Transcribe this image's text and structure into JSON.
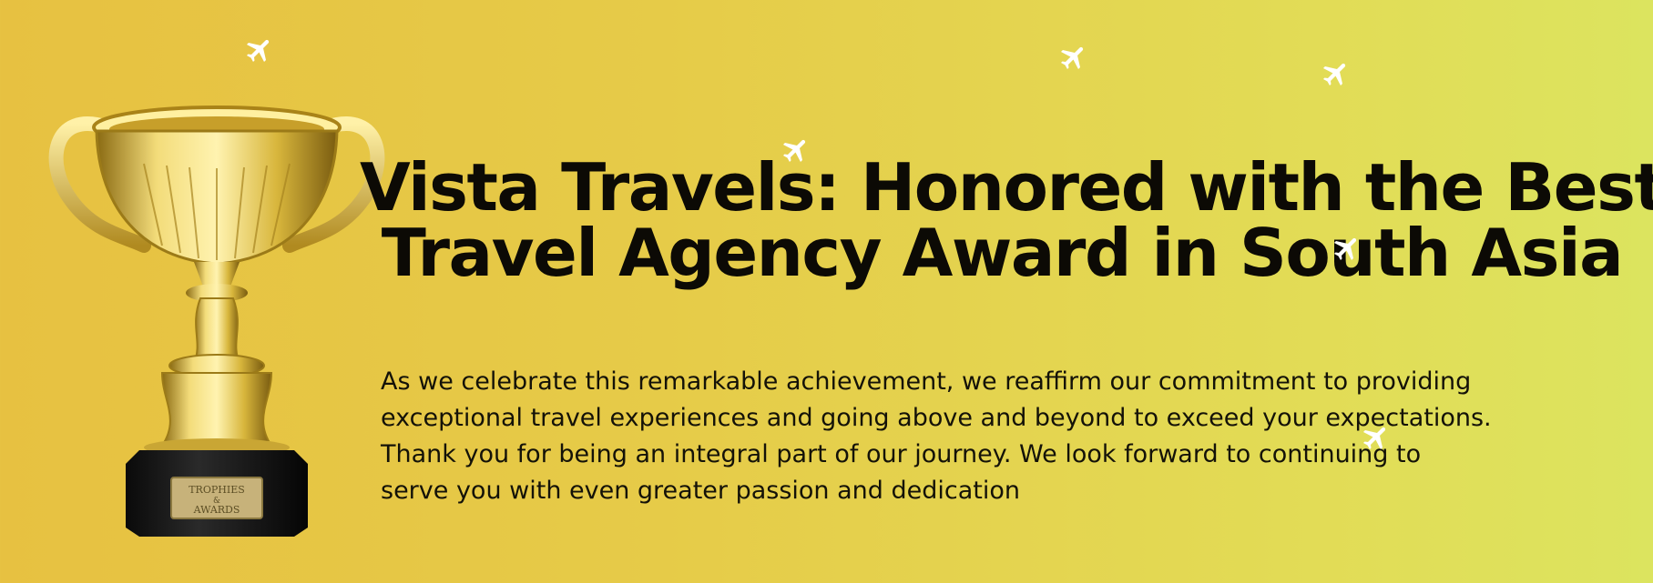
{
  "banner": {
    "title_lines": [
      "Vista Travels: Honored with the Best",
      "Travel Agency Award in South Asia"
    ],
    "body_lines": [
      "As we celebrate this remarkable achievement, we reaffirm our commitment to providing",
      "exceptional travel experiences and going above and beyond to exceed your expectations.",
      "Thank you for being an integral part of our journey. We look forward to continuing to",
      "serve you with even greater passion and dedication"
    ],
    "trophy_plaque_text": "TROPHIES & AWARDS",
    "icons": {
      "trophy": "trophy-icon",
      "plane": "airplane-icon"
    },
    "colors": {
      "background_start": "#e7c141",
      "background_end": "#dce45f",
      "text": "#0c0a05",
      "gold": "#d9b52a",
      "plane": "#ffffff"
    }
  }
}
